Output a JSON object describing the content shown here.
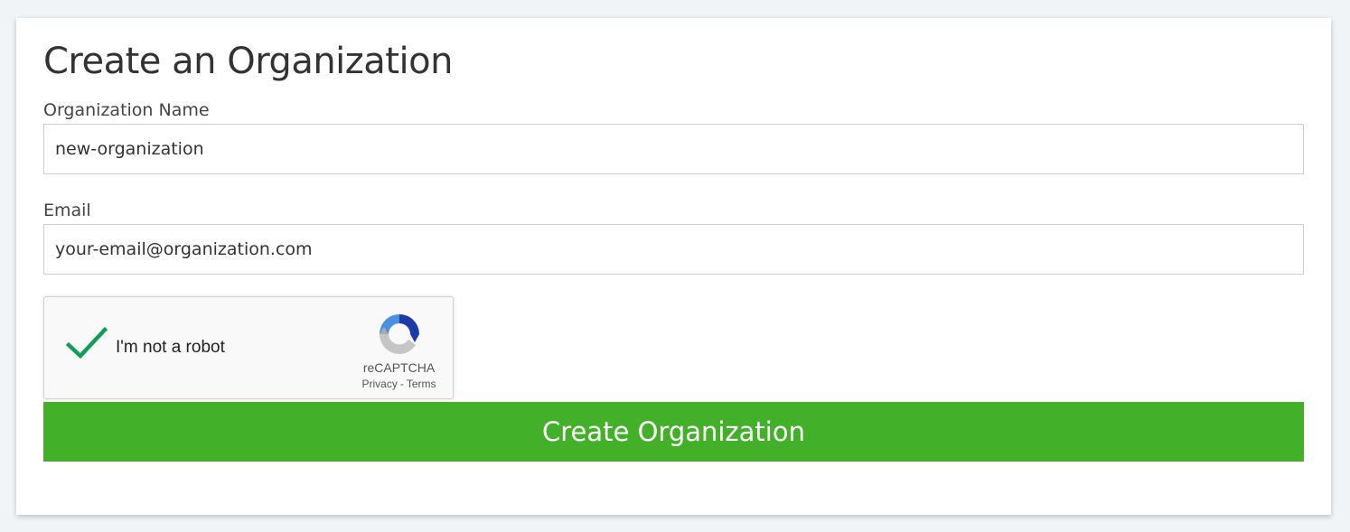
{
  "form": {
    "title": "Create an Organization",
    "org_name_label": "Organization Name",
    "org_name_value": "new-organization",
    "email_label": "Email",
    "email_value": "your-email@organization.com",
    "submit_label": "Create Organization"
  },
  "recaptcha": {
    "label": "I'm not a robot",
    "checked": true,
    "brand": "reCAPTCHA",
    "privacy_link": "Privacy",
    "separator": "-",
    "terms_link": "Terms",
    "check_icon": "checkmark-icon",
    "logo_icon": "recaptcha-logo-icon",
    "check_color": "#0f9d58"
  },
  "colors": {
    "page_bg": "#f1f4f7",
    "card_bg": "#ffffff",
    "button_bg": "#43b02a",
    "button_text": "#ffffff"
  }
}
